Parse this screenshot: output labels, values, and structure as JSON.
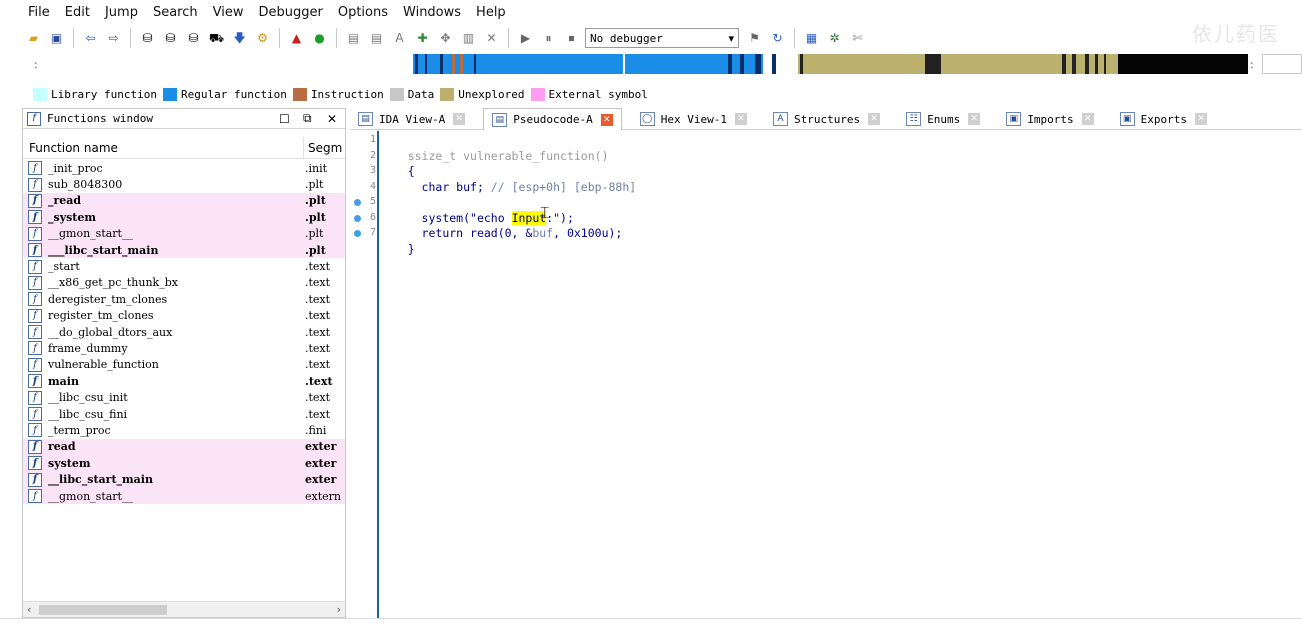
{
  "menu": [
    "File",
    "Edit",
    "Jump",
    "Search",
    "View",
    "Debugger",
    "Options",
    "Windows",
    "Help"
  ],
  "toolbar": {
    "debugger_value": "No debugger",
    "watermark": "依儿药医"
  },
  "colors": {
    "library": "#c6ffff",
    "regular": "#1a8ee6",
    "instruction": "#b86d42",
    "data": "#c7c7c7",
    "unexplored": "#bcb06f",
    "external": "#ff9ef0",
    "tab_close_active": "#e85a2b",
    "gutter_dot": "#3fa0e3"
  },
  "legend": [
    {
      "label": "Library function",
      "color_key": "library"
    },
    {
      "label": "Regular function",
      "color_key": "regular"
    },
    {
      "label": "Instruction",
      "color_key": "instruction"
    },
    {
      "label": "Data",
      "color_key": "data"
    },
    {
      "label": "Unexplored",
      "color_key": "unexplored"
    },
    {
      "label": "External symbol",
      "color_key": "external"
    }
  ],
  "functions_window": {
    "title": "Functions window",
    "col_name": "Function name",
    "col_segment": "Segm",
    "rows": [
      {
        "name": "_init_proc",
        "seg": ".init",
        "pink": false,
        "bold": false
      },
      {
        "name": "sub_8048300",
        "seg": ".plt",
        "pink": false,
        "bold": false
      },
      {
        "name": "_read",
        "seg": ".plt",
        "pink": true,
        "bold": true
      },
      {
        "name": "_system",
        "seg": ".plt",
        "pink": true,
        "bold": true
      },
      {
        "name": "__gmon_start__",
        "seg": ".plt",
        "pink": true,
        "bold": false
      },
      {
        "name": "___libc_start_main",
        "seg": ".plt",
        "pink": true,
        "bold": true
      },
      {
        "name": "_start",
        "seg": ".text",
        "pink": false,
        "bold": false
      },
      {
        "name": "__x86_get_pc_thunk_bx",
        "seg": ".text",
        "pink": false,
        "bold": false
      },
      {
        "name": "deregister_tm_clones",
        "seg": ".text",
        "pink": false,
        "bold": false
      },
      {
        "name": "register_tm_clones",
        "seg": ".text",
        "pink": false,
        "bold": false
      },
      {
        "name": "__do_global_dtors_aux",
        "seg": ".text",
        "pink": false,
        "bold": false
      },
      {
        "name": "frame_dummy",
        "seg": ".text",
        "pink": false,
        "bold": false
      },
      {
        "name": "vulnerable_function",
        "seg": ".text",
        "pink": false,
        "bold": false
      },
      {
        "name": "main",
        "seg": ".text",
        "pink": false,
        "bold": true
      },
      {
        "name": "__libc_csu_init",
        "seg": ".text",
        "pink": false,
        "bold": false
      },
      {
        "name": "__libc_csu_fini",
        "seg": ".text",
        "pink": false,
        "bold": false
      },
      {
        "name": "_term_proc",
        "seg": ".fini",
        "pink": false,
        "bold": false
      },
      {
        "name": "read",
        "seg": "exter",
        "pink": true,
        "bold": true
      },
      {
        "name": "system",
        "seg": "exter",
        "pink": true,
        "bold": true
      },
      {
        "name": "__libc_start_main",
        "seg": "exter",
        "pink": true,
        "bold": true
      },
      {
        "name": "__gmon_start__",
        "seg": "extern",
        "pink": true,
        "bold": false
      }
    ]
  },
  "tabs": [
    {
      "label": "IDA View-A",
      "icon": "ida-view-icon",
      "active": false
    },
    {
      "label": "Pseudocode-A",
      "icon": "pseudocode-icon",
      "active": true
    },
    {
      "label": "Hex View-1",
      "icon": "hex-view-icon",
      "active": false
    },
    {
      "label": "Structures",
      "icon": "structures-icon",
      "active": false
    },
    {
      "label": "Enums",
      "icon": "enums-icon",
      "active": false
    },
    {
      "label": "Imports",
      "icon": "imports-icon",
      "active": false
    },
    {
      "label": "Exports",
      "icon": "exports-icon",
      "active": false
    }
  ],
  "code": {
    "lines": [
      {
        "num": "1",
        "dot": false
      },
      {
        "num": "2",
        "dot": false
      },
      {
        "num": "3",
        "dot": false
      },
      {
        "num": "4",
        "dot": false
      },
      {
        "num": "5",
        "dot": true
      },
      {
        "num": "6",
        "dot": true
      },
      {
        "num": "7",
        "dot": true
      }
    ],
    "l1": "ssize_t vulnerable_function()",
    "l2": "{",
    "l3a": "  char buf; ",
    "l3b": "// [esp+0h] [ebp-88h]",
    "l5a": "  system(\"echo ",
    "l5b": "Input",
    "l5c": ":\");",
    "l6a": "  return read(0, &",
    "l6b": "buf",
    "l6c": ", 0x100u);",
    "l7": "}"
  }
}
